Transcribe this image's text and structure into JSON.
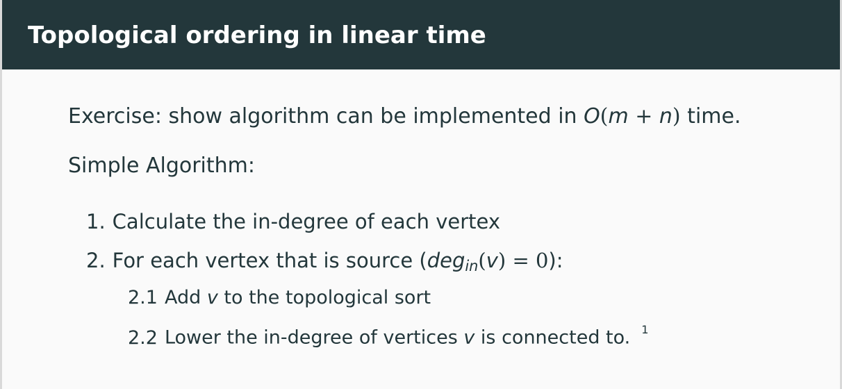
{
  "slide": {
    "title": "Topological ordering in linear time"
  },
  "exercise": {
    "text": "Exercise: show algorithm can be implemented in ",
    "complexity": {
      "O": "O",
      "open": "(",
      "m": "m",
      "plus": " + ",
      "n": "n",
      "close": ")"
    },
    "suffix": " time."
  },
  "simple_algorithm": {
    "heading": "Simple Algorithm:"
  },
  "steps": [
    {
      "number": "1.",
      "text": "Calculate the in-degree of each vertex"
    },
    {
      "number": "2.",
      "text_before": "For each vertex that is source (",
      "deg": "deg",
      "deg_sub": "in",
      "paren_open": "(",
      "v": "v",
      "paren_close": ")",
      "equals_zero": " = 0",
      "text_after": "):",
      "substeps": [
        {
          "number": "2.1",
          "before": "Add ",
          "v": "v",
          "after": " to the topological sort"
        },
        {
          "number": "2.2",
          "before": "Lower the in-degree of vertices ",
          "v": "v",
          "after": " is connected to.",
          "footnote": "1"
        }
      ]
    }
  ]
}
